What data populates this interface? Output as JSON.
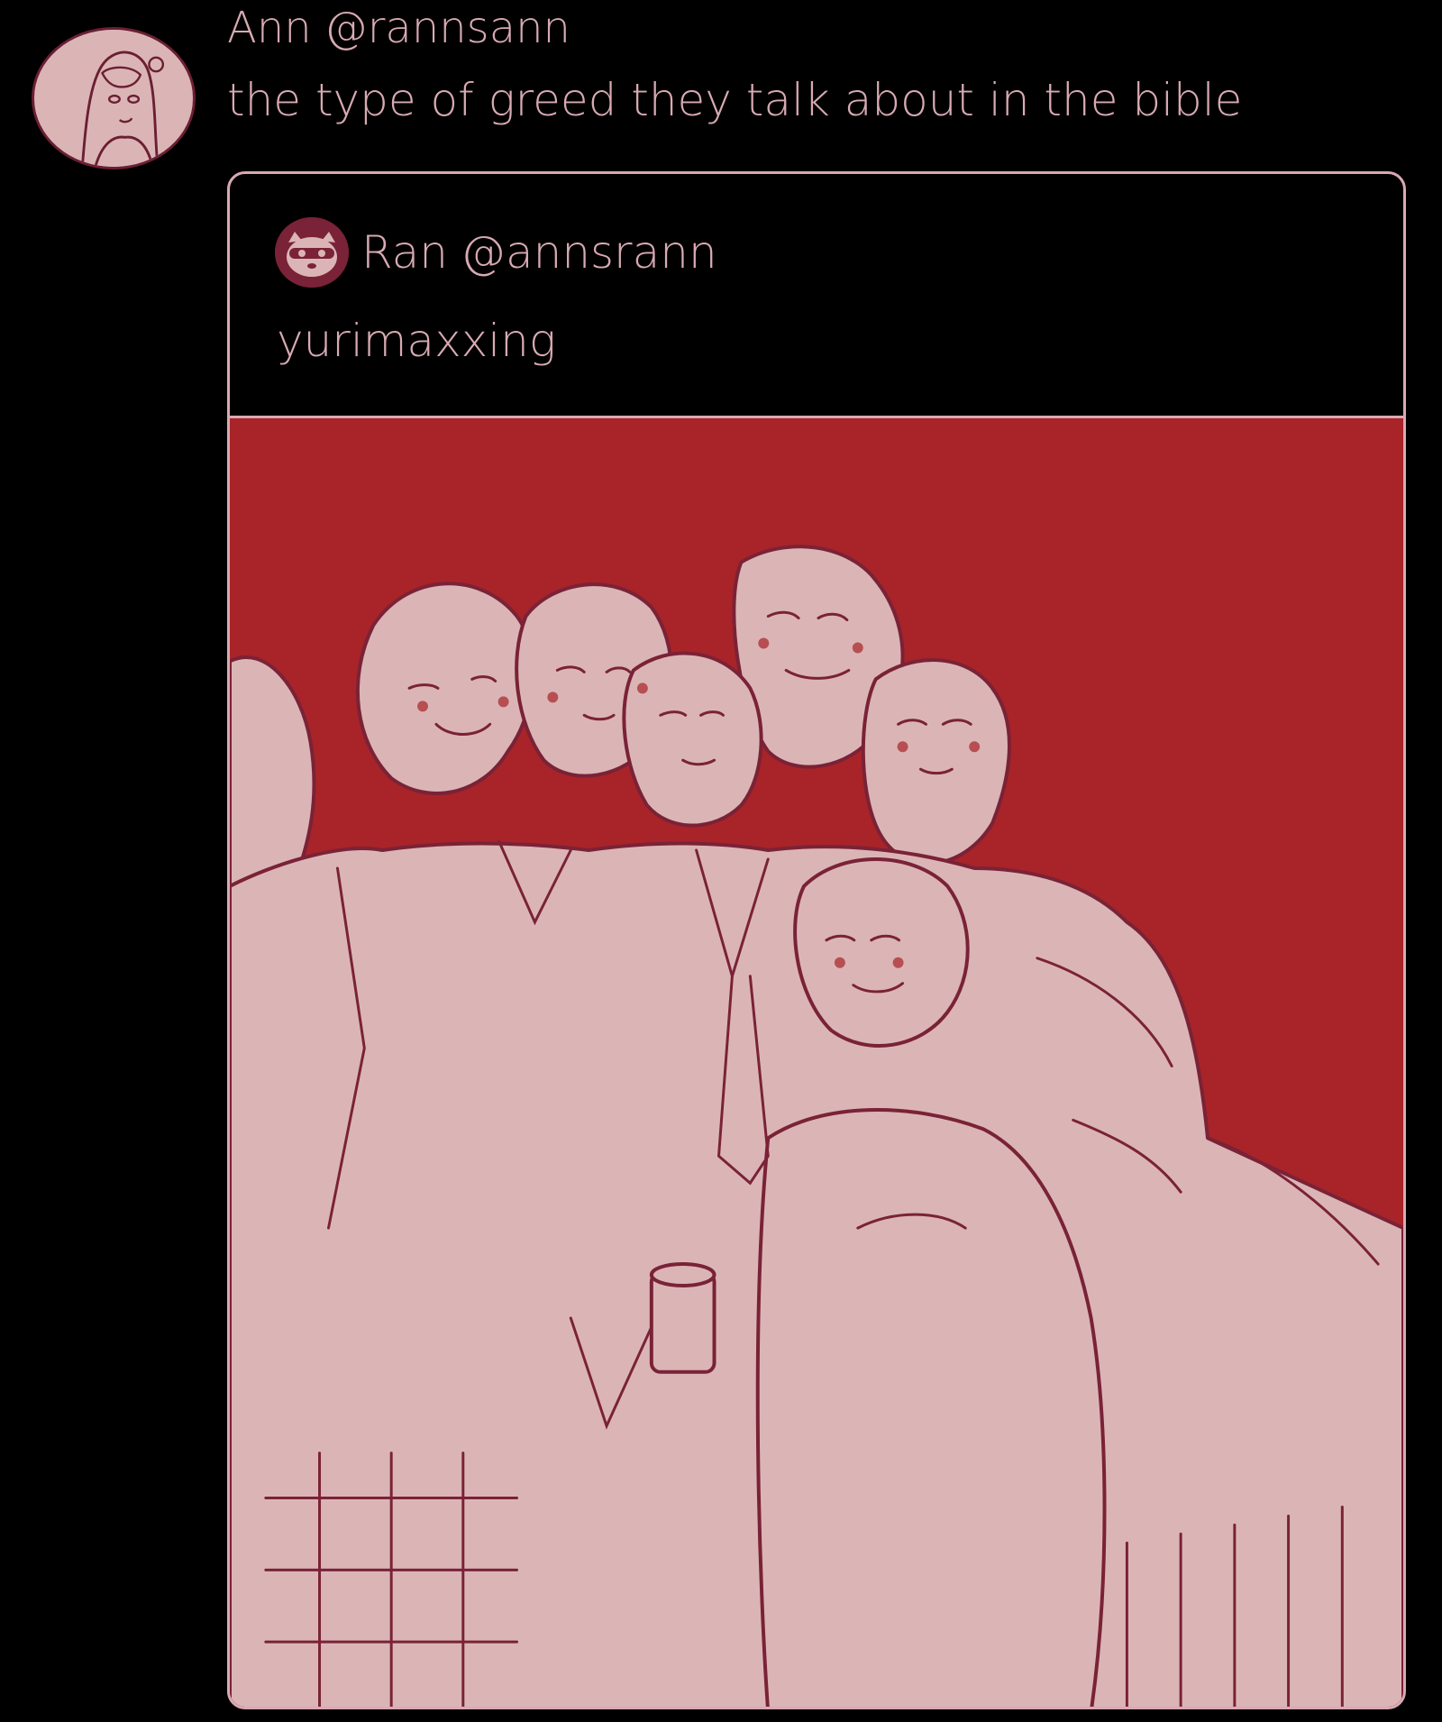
{
  "tweet": {
    "author_name": "Ann",
    "author_handle": "@rannsann",
    "text": "the type of greed they talk about in the bible",
    "avatar_icon": "profile-portrait-icon"
  },
  "quoted_tweet": {
    "author_name": "Ran",
    "author_handle": "@annsrann",
    "text": "yurimaxxing",
    "avatar_icon": "raccoon-avatar-icon",
    "media_description_icon": "group-illustration"
  },
  "colors": {
    "background": "#000000",
    "text": "#d8aab3",
    "media_background": "#a82428",
    "figure_fill": "#dbb5b6",
    "line": "#7a2237"
  }
}
